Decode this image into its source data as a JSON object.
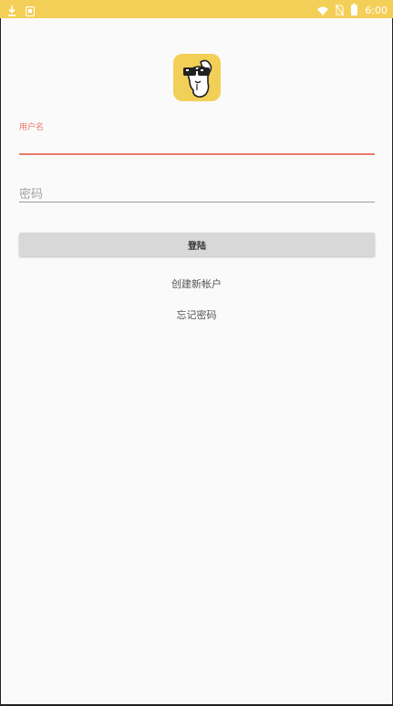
{
  "status_bar": {
    "time": "6:00",
    "left_icons": [
      "download-icon",
      "app-notification-icon"
    ],
    "right_icons": [
      "wifi-icon",
      "no-sim-icon",
      "battery-icon"
    ],
    "color": "#f3cf57"
  },
  "login_form": {
    "username_label": "用户名",
    "username_value": "",
    "password_placeholder": "密码",
    "password_value": "",
    "login_button": "登陆",
    "create_account_link": "创建新帐户",
    "forgot_password_link": "忘记密码"
  },
  "colors": {
    "accent": "#ea7a68",
    "brand_yellow": "#f2cf56",
    "button_bg": "#d8d8d8",
    "background": "#fafafa"
  }
}
